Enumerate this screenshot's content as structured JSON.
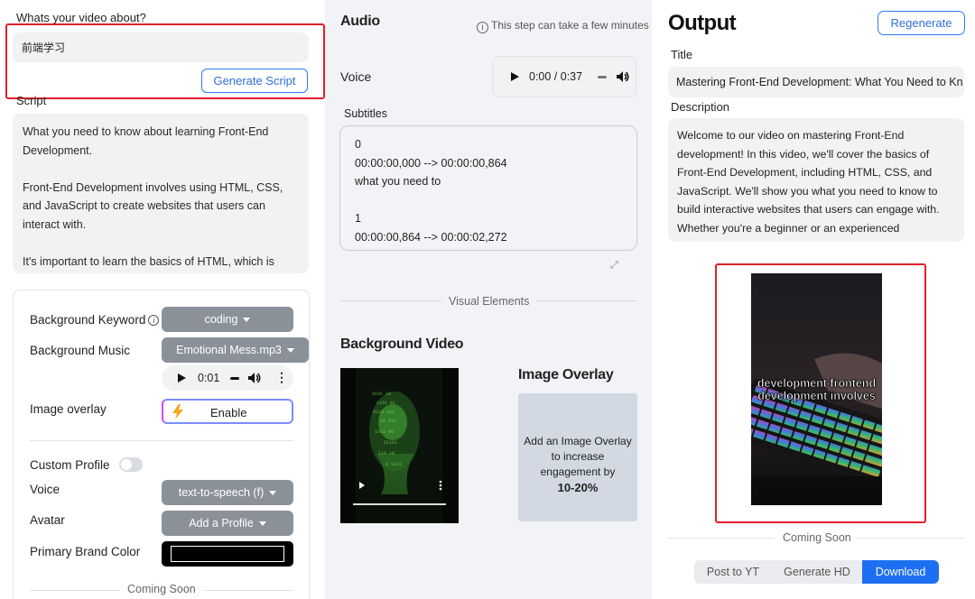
{
  "left": {
    "question_label": "Whats your video about?",
    "topic_value": "前端学习",
    "generate_script_label": "Generate Script",
    "script_label": "Script",
    "script_paragraphs": [
      "What you need to know about learning Front-End Development.",
      "Front-End Development involves using HTML, CSS, and JavaScript to create websites that users can interact with.",
      "It's important to learn the basics of HTML, which is"
    ],
    "background_keyword_label": "Background Keyword",
    "background_keyword_value": "coding",
    "background_music_label": "Background Music",
    "background_music_value": "Emotional Mess.mp3",
    "music_time": "0:01",
    "image_overlay_label": "Image overlay",
    "enable_label": "Enable",
    "custom_profile_label": "Custom Profile",
    "voice_label": "Voice",
    "voice_value": "text-to-speech (f)",
    "avatar_label": "Avatar",
    "avatar_value": "Add a Profile",
    "brand_color_label": "Primary Brand Color",
    "brand_color": "#000000",
    "coming_soon": "Coming Soon"
  },
  "middle": {
    "audio_title": "Audio",
    "audio_hint": "This step can take a few minutes",
    "voice_label": "Voice",
    "audio_time": "0:00 / 0:37",
    "subtitles_label": "Subtitles",
    "subtitles_lines": [
      "0",
      "00:00:00,000 --> 00:00:00,864",
      "what you need to",
      "",
      "1",
      "00:00:00,864 --> 00:00:02,272"
    ],
    "visual_elements_label": "Visual Elements",
    "background_video_title": "Background Video",
    "image_overlay_title": "Image Overlay",
    "overlay_text_line1": "Add an Image Overlay to increase engagement by",
    "overlay_text_line2": "10-20%"
  },
  "right": {
    "output_title": "Output",
    "regenerate_label": "Regenerate",
    "title_label": "Title",
    "title_value": "Mastering Front-End Development: What You Need to Kn",
    "description_label": "Description",
    "description_value": "Welcome to our video on mastering Front-End development! In this video, we'll cover the basics of Front-End Development, including HTML, CSS, and JavaScript. We'll show you what you need to know to build interactive websites that users can engage with. Whether you're a beginner or an experienced",
    "caption_line1": "development frontend",
    "caption_line2": "development involves",
    "coming_soon": "Coming Soon",
    "actions": [
      "Post to YT",
      "Generate HD",
      "Download"
    ]
  },
  "colors": {
    "accent_blue": "#2f7bf5",
    "highlight_red": "#e0202a",
    "dropdown_gray": "#8b9199",
    "download_blue": "#1d6ff2"
  }
}
